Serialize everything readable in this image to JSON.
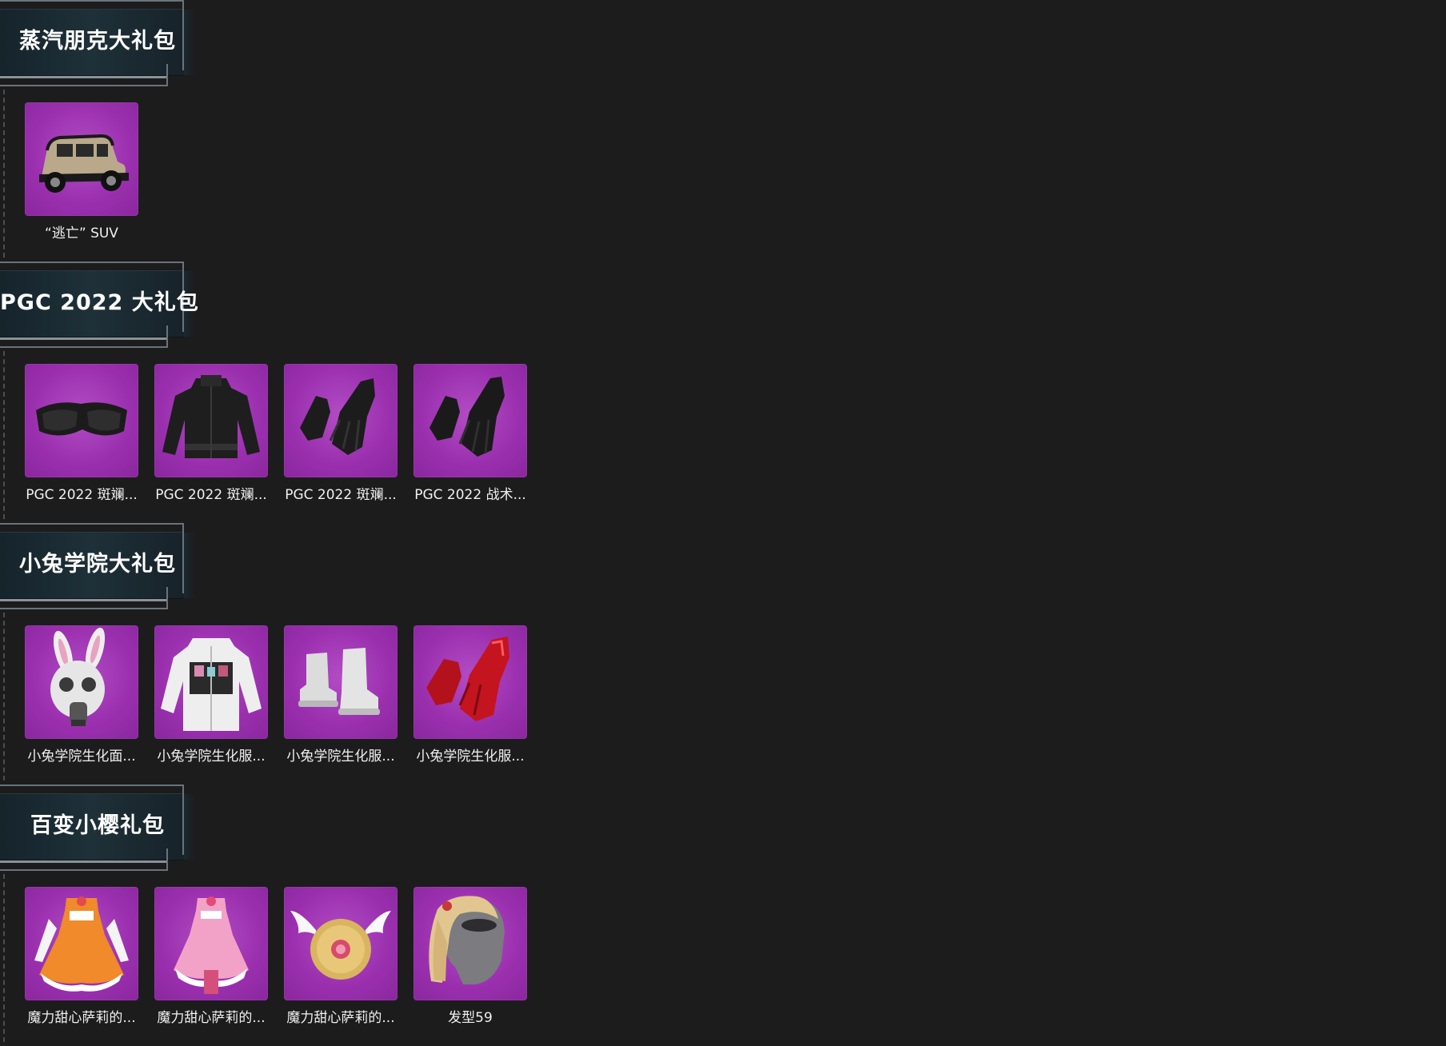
{
  "sections": [
    {
      "title": "蒸汽朋克大礼包",
      "items": [
        {
          "name": "“逃亡” SUV",
          "icon": "car-icon"
        }
      ]
    },
    {
      "title": "PGC 2022 大礼包",
      "items": [
        {
          "name": "PGC 2022 斑斓...",
          "icon": "goggles-icon"
        },
        {
          "name": "PGC 2022 斑斓...",
          "icon": "jacket-icon"
        },
        {
          "name": "PGC 2022 斑斓...",
          "icon": "gloves-icon"
        },
        {
          "name": "PGC 2022 战术...",
          "icon": "gloves-icon"
        }
      ]
    },
    {
      "title": "小兔学院大礼包",
      "items": [
        {
          "name": "小兔学院生化面...",
          "icon": "bunny-gas-mask-icon"
        },
        {
          "name": "小兔学院生化服...",
          "icon": "lab-coat-icon"
        },
        {
          "name": "小兔学院生化服...",
          "icon": "boots-icon"
        },
        {
          "name": "小兔学院生化服...",
          "icon": "red-gloves-icon"
        }
      ]
    },
    {
      "title": "百变小樱礼包",
      "items": [
        {
          "name": "魔力甜心萨莉的...",
          "icon": "orange-dress-icon"
        },
        {
          "name": "魔力甜心萨莉的...",
          "icon": "pink-dress-icon"
        },
        {
          "name": "魔力甜心萨莉的...",
          "icon": "winged-backpack-icon"
        },
        {
          "name": "发型59",
          "icon": "hairstyle-icon"
        }
      ]
    }
  ],
  "colors": {
    "background": "#1c1c1d",
    "item_bg": "#9a2fae",
    "header_bg": "#1e3038"
  }
}
